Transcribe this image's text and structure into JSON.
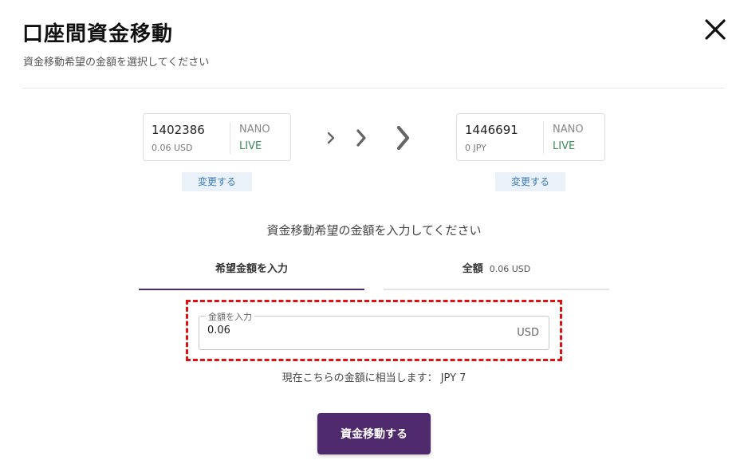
{
  "header": {
    "title": "口座間資金移動",
    "subtitle": "資金移動希望の金額を選択してください"
  },
  "from_account": {
    "number": "1402386",
    "balance": "0.06 USD",
    "type": "NANO",
    "status": "LIVE",
    "change_label": "変更する"
  },
  "to_account": {
    "number": "1446691",
    "balance": "0 JPY",
    "type": "NANO",
    "status": "LIVE",
    "change_label": "変更する"
  },
  "instruction": "資金移動希望の金額を入力してください",
  "tabs": [
    {
      "label": "希望金額を入力",
      "active": true
    },
    {
      "label": "全額",
      "amount": "0.06 USD",
      "active": false
    }
  ],
  "amount_field": {
    "label": "金額を入力",
    "value": "0.06",
    "unit": "USD"
  },
  "equivalent": "現在こちらの金額に相当します： JPY 7",
  "submit_label": "資金移動する",
  "colors": {
    "accent": "#4e2a6d",
    "live": "#3b8a5a",
    "change_bg": "#eaf1f8",
    "change_text": "#3a7cc0",
    "highlight": "#e01010"
  }
}
